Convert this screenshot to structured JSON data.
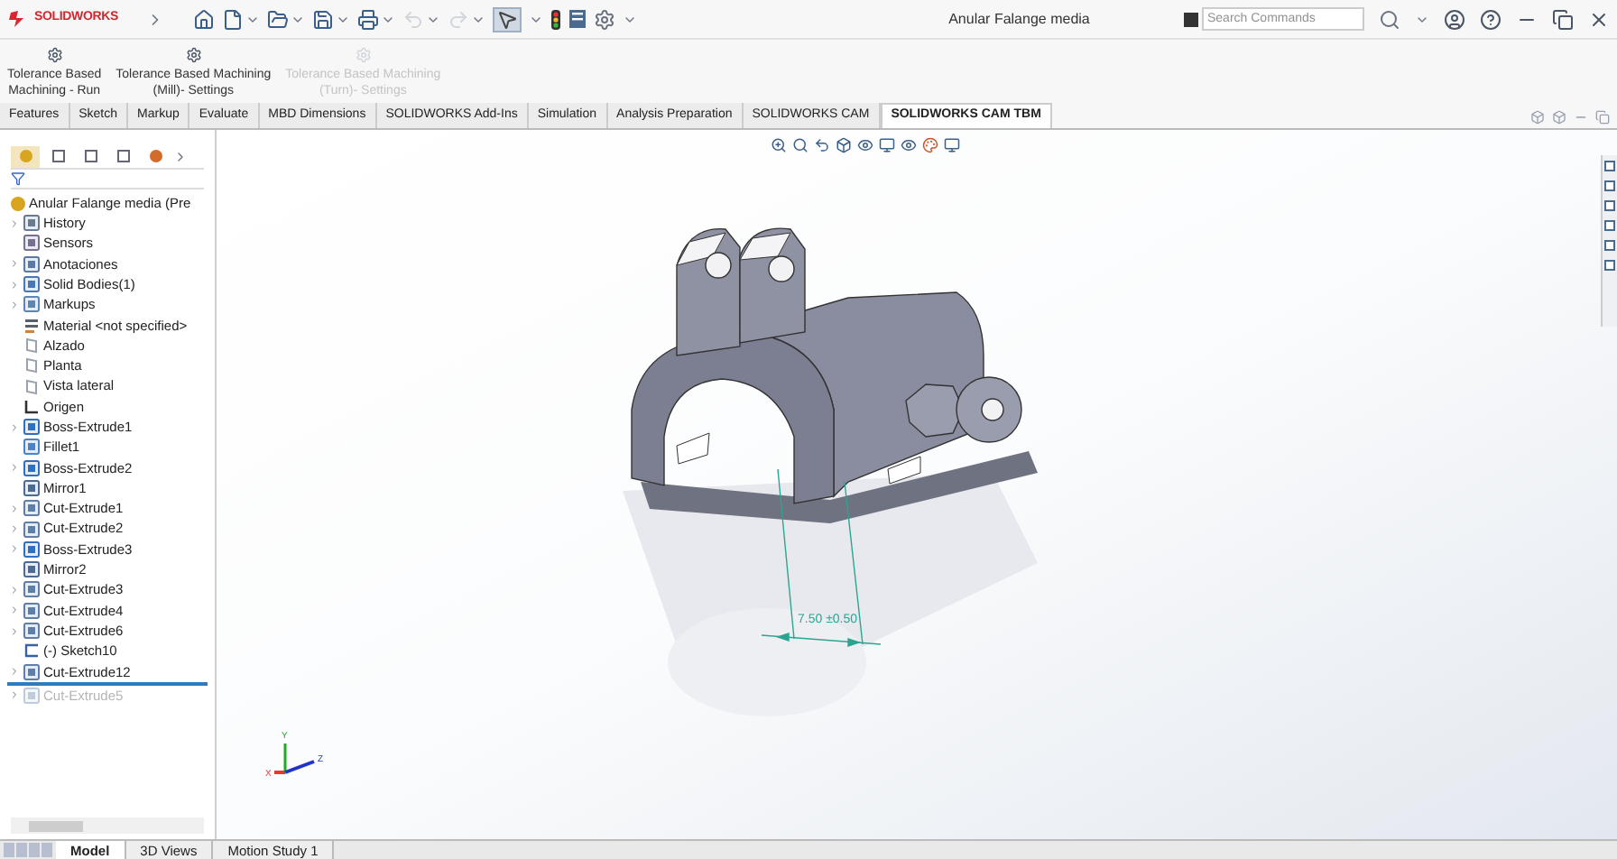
{
  "app": {
    "logo": "SOLIDWORKS"
  },
  "window": {
    "title": "Anular Falange media"
  },
  "search": {
    "placeholder": "Search Commands"
  },
  "ribbon": {
    "commands": [
      {
        "lines": [
          "Tolerance Based",
          "Machining - Run"
        ],
        "disabled": false
      },
      {
        "lines": [
          "Tolerance Based Machining",
          "(Mill)- Settings"
        ],
        "disabled": false
      },
      {
        "lines": [
          "Tolerance Based Machining",
          "(Turn)- Settings"
        ],
        "disabled": true
      }
    ]
  },
  "tabs": [
    {
      "label": "Features",
      "selected": false
    },
    {
      "label": "Sketch",
      "selected": false
    },
    {
      "label": "Markup",
      "selected": false
    },
    {
      "label": "Evaluate",
      "selected": false
    },
    {
      "label": "MBD Dimensions",
      "selected": false
    },
    {
      "label": "SOLIDWORKS Add-Ins",
      "selected": false
    },
    {
      "label": "Simulation",
      "selected": false
    },
    {
      "label": "Analysis Preparation",
      "selected": false
    },
    {
      "label": "SOLIDWORKS CAM",
      "selected": false
    },
    {
      "label": "SOLIDWORKS CAM TBM",
      "selected": true
    }
  ],
  "tree": {
    "root": "Anular Falange media (Pre",
    "items": [
      {
        "label": "History",
        "kind": "history",
        "expandable": true,
        "suppressed": false
      },
      {
        "label": "Sensors",
        "kind": "sensors",
        "expandable": false,
        "suppressed": false
      },
      {
        "label": "Anotaciones",
        "kind": "annotations",
        "expandable": true,
        "suppressed": false
      },
      {
        "label": "Solid Bodies(1)",
        "kind": "bodies",
        "expandable": true,
        "suppressed": false
      },
      {
        "label": "Markups",
        "kind": "markups",
        "expandable": true,
        "suppressed": false
      },
      {
        "label": "Material <not specified>",
        "kind": "material",
        "expandable": false,
        "suppressed": false
      },
      {
        "label": "Alzado",
        "kind": "plane",
        "expandable": false,
        "suppressed": false
      },
      {
        "label": "Planta",
        "kind": "plane",
        "expandable": false,
        "suppressed": false
      },
      {
        "label": "Vista lateral",
        "kind": "plane",
        "expandable": false,
        "suppressed": false
      },
      {
        "label": "Origen",
        "kind": "origin",
        "expandable": false,
        "suppressed": false
      },
      {
        "label": "Boss-Extrude1",
        "kind": "boss",
        "expandable": true,
        "suppressed": false
      },
      {
        "label": "Fillet1",
        "kind": "fillet",
        "expandable": false,
        "suppressed": false
      },
      {
        "label": "Boss-Extrude2",
        "kind": "boss",
        "expandable": true,
        "suppressed": false
      },
      {
        "label": "Mirror1",
        "kind": "mirror",
        "expandable": false,
        "suppressed": false
      },
      {
        "label": "Cut-Extrude1",
        "kind": "cut",
        "expandable": true,
        "suppressed": false
      },
      {
        "label": "Cut-Extrude2",
        "kind": "cut",
        "expandable": true,
        "suppressed": false
      },
      {
        "label": "Boss-Extrude3",
        "kind": "boss",
        "expandable": true,
        "suppressed": false
      },
      {
        "label": "Mirror2",
        "kind": "mirror",
        "expandable": false,
        "suppressed": false
      },
      {
        "label": "Cut-Extrude3",
        "kind": "cut",
        "expandable": true,
        "suppressed": false
      },
      {
        "label": "Cut-Extrude4",
        "kind": "cut",
        "expandable": true,
        "suppressed": false
      },
      {
        "label": "Cut-Extrude6",
        "kind": "cut",
        "expandable": true,
        "suppressed": false
      },
      {
        "label": "(-) Sketch10",
        "kind": "sketch",
        "expandable": false,
        "suppressed": false
      },
      {
        "label": "Cut-Extrude12",
        "kind": "cut",
        "expandable": true,
        "suppressed": false,
        "rollback_after": true
      },
      {
        "label": "Cut-Extrude5",
        "kind": "cut",
        "expandable": true,
        "suppressed": true,
        "rollback_after": false
      }
    ]
  },
  "dimension": {
    "text": "7.50 ±0.50"
  },
  "triad": {
    "x": "X",
    "y": "Y",
    "z": "Z"
  },
  "bottom_tabs": [
    {
      "label": "Model",
      "selected": true
    },
    {
      "label": "3D Views",
      "selected": false
    },
    {
      "label": "Motion Study 1",
      "selected": false
    }
  ]
}
